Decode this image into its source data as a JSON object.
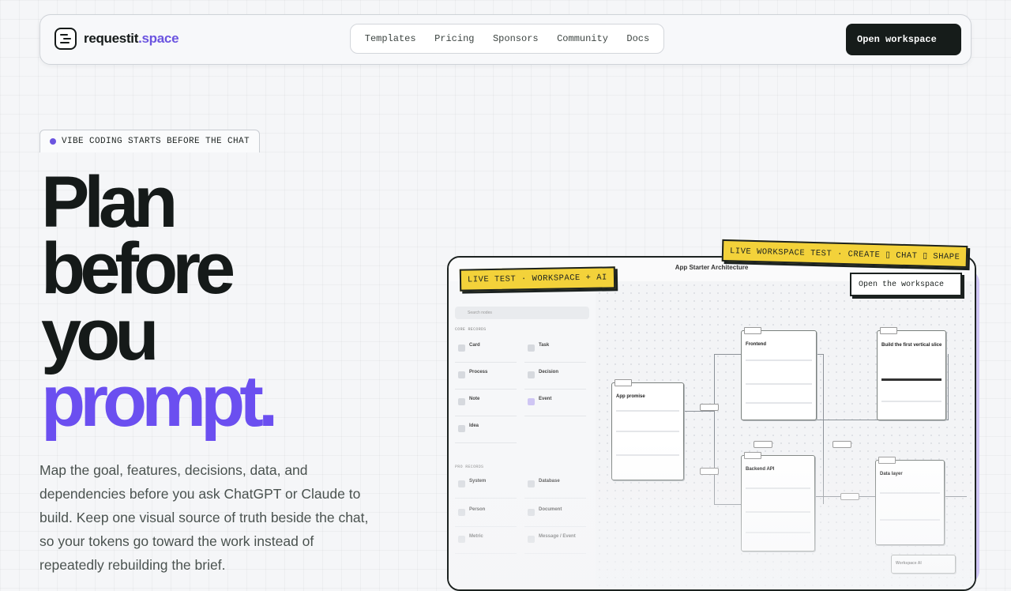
{
  "brand": {
    "name": "requestit",
    "tld": ".space"
  },
  "nav": {
    "items": [
      "Templates",
      "Pricing",
      "Sponsors",
      "Community",
      "Docs"
    ]
  },
  "header_cta": "Open workspace",
  "hero": {
    "eyebrow": "VIBE CODING STARTS BEFORE THE CHAT",
    "headline": [
      "Plan",
      "before",
      "you",
      "prompt."
    ],
    "lead": "Map the goal, features, decisions, data, and dependencies before you ask ChatGPT or Claude to build. Keep one visual source of truth beside the chat, so your tokens go toward the work instead of repeatedly rebuilding the brief."
  },
  "preview": {
    "title": "App Starter Architecture",
    "sticker_left": "LIVE TEST · WORKSPACE + AI",
    "sticker_right": "LIVE WORKSPACE TEST · CREATE ▯ CHAT ▯ SHAPE",
    "open_button": "Open the workspace",
    "search_placeholder": "Search nodes",
    "core_label": "CORE RECORDS",
    "pro_label": "PRO RECORDS",
    "core_records": [
      "Card",
      "Task",
      "Process",
      "Decision",
      "Note",
      "Event",
      "Idea"
    ],
    "pro_records": [
      "System",
      "Database",
      "Person",
      "Document",
      "Metric",
      "Message / Event"
    ],
    "nodes": [
      "App promise",
      "Frontend",
      "Build the first vertical slice",
      "Backend API",
      "Data layer",
      "Workspace AI"
    ]
  },
  "colors": {
    "accent": "#6b4ff0",
    "dark": "#151a19",
    "sticker": "#f3d23a"
  }
}
